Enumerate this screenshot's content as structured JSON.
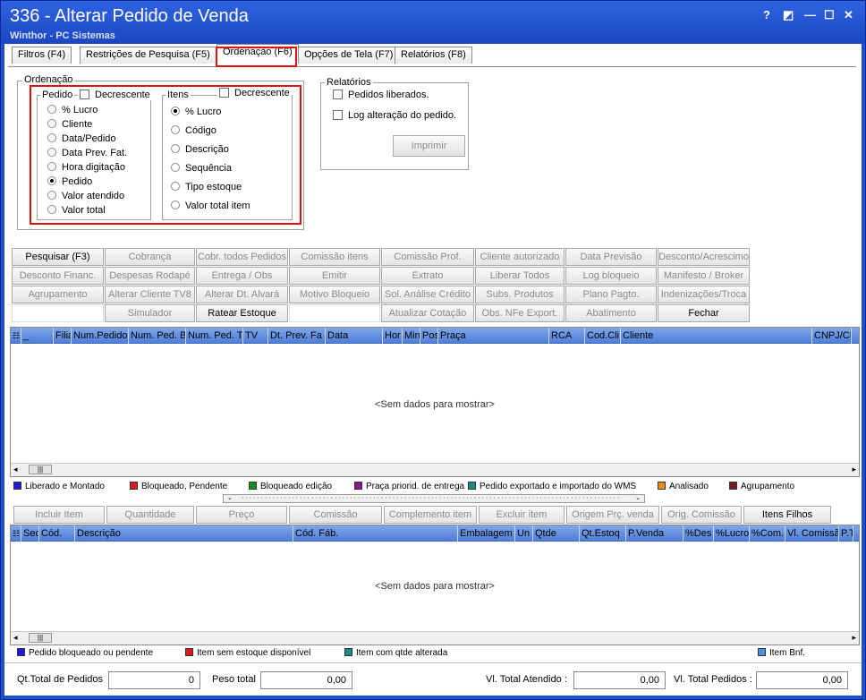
{
  "window": {
    "title": "336 - Alterar Pedido de Venda",
    "subtitle": "Winthor - PC Sistemas",
    "controls": [
      "?",
      "◩",
      "—",
      "☐",
      "✕"
    ]
  },
  "tabs": [
    "Filtros (F4)",
    "Restrições de Pesquisa (F5)",
    "Ordenação (F6)",
    "Opções de Tela (F7)",
    "Relatórios (F8)"
  ],
  "ordenacao": {
    "title": "Ordenação",
    "pedido": {
      "title": "Pedido",
      "decrescente": "Decrescente",
      "options": [
        "% Lucro",
        "Cliente",
        "Data/Pedido",
        "Data Prev. Fat.",
        "Hora digitação",
        "Pedido",
        "Valor atendido",
        "Valor total"
      ],
      "selected": "Pedido"
    },
    "itens": {
      "title": "Itens",
      "decrescente": "Decrescente",
      "options": [
        "% Lucro",
        "Código",
        "Descrição",
        "Sequência",
        "Tipo estoque",
        "Valor total item"
      ],
      "selected": "% Lucro"
    }
  },
  "relatorios": {
    "title": "Relatórios",
    "check1": "Pedidos liberados.",
    "check2": "Log alteração do pedido.",
    "print": "Imprimir"
  },
  "buttons": {
    "row1": [
      "Pesquisar (F3)",
      "Cobrança",
      "Cobr. todos Pedidos",
      "Comissão itens",
      "Comissão Prof.",
      "Cliente autorizado",
      "Data Previsão",
      "Desconto/Acrescimo"
    ],
    "row2": [
      "Desconto Financ.",
      "Despesas Rodapé",
      "Entrega / Obs",
      "Emitir",
      "Extrato",
      "Liberar Todos",
      "Log bloqueio",
      "Manifesto / Broker"
    ],
    "row3": [
      "Agrupamento",
      "Alterar Cliente TV8",
      "Alterar Dt. Alvará",
      "Motivo Bloqueio",
      "Sol. Análise Crédito",
      "Subs. Produtos",
      "Plano Pagto.",
      "Indenizações/Troca"
    ],
    "row4": [
      "",
      "Simulador",
      "Ratear Estoque",
      "",
      "Atualizar Cotação",
      "Obs. NFe Export.",
      "Abatimento",
      "Fechar"
    ]
  },
  "grid1": {
    "columns": [
      "_",
      "Filia",
      "Num.Pedido",
      "Num. Ped. B",
      "Num. Ped. T",
      "TV",
      "Dt. Prev. Fa",
      "Data",
      "Hor",
      "Min",
      "Pos",
      "Praça",
      "RCA",
      "Cod.Cli",
      "Cliente",
      "CNPJ/CPF"
    ],
    "empty": "<Sem dados para mostrar>"
  },
  "legend1": [
    {
      "label": "Liberado e Montado",
      "color": "#1a1ae0"
    },
    {
      "label": "Bloqueado, Pendente",
      "color": "#e01a1a"
    },
    {
      "label": "Bloqueado edição",
      "color": "#1a8a1a"
    },
    {
      "label": "Praça priorid. de entrega",
      "color": "#8a1a8a"
    },
    {
      "label": "Pedido exportado e importado do WMS",
      "color": "#1a8a8a"
    },
    {
      "label": "Analisado",
      "color": "#f08a1a"
    },
    {
      "label": "Agrupamento",
      "color": "#7a1a1a"
    }
  ],
  "itemButtons": [
    "Incluir Item",
    "Quantidade",
    "Preço",
    "Comissão",
    "Complemento item",
    "Excluir item",
    "Origem Prç. venda",
    "Orig. Comissão",
    "Itens Filhos"
  ],
  "grid2": {
    "columns": [
      "Seq",
      "Cód.",
      "Descrição",
      "Cód. Fáb.",
      "Embalagem",
      "Un",
      "Qtde",
      "Qt.Estoq",
      "P.Venda",
      "%Des",
      "%Lucro",
      "%Com.",
      "Vl. Comissão",
      "P.T"
    ],
    "empty": "<Sem dados para mostrar>"
  },
  "legend2": [
    {
      "label": "Pedido bloqueado ou pendente",
      "color": "#1a1ae0"
    },
    {
      "label": "Item sem estoque disponível",
      "color": "#e01a1a"
    },
    {
      "label": "Item com qtde alterada",
      "color": "#1a8a8a"
    },
    {
      "label": "Item Bnf.",
      "color": "#4a90e0"
    }
  ],
  "footer": {
    "qt_label": "Qt.Total de Pedidos",
    "qt_value": "0",
    "peso_label": "Peso total",
    "peso_value": "0,00",
    "atend_label": "Vl. Total Atendido :",
    "atend_value": "0,00",
    "ped_label": "Vl. Total Pedidos :",
    "ped_value": "0,00"
  }
}
